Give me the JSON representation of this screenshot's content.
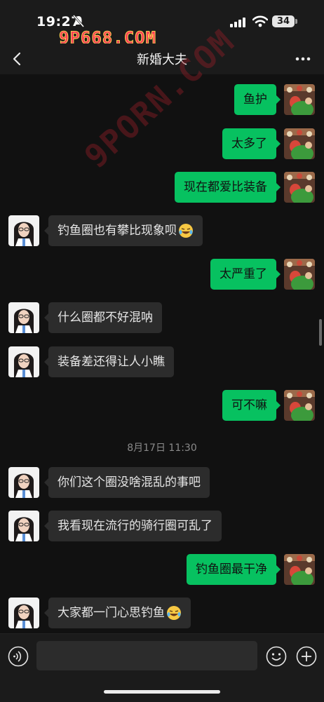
{
  "status_bar": {
    "time": "19:27",
    "battery": "34",
    "watermark_text": "9P668.COM"
  },
  "header": {
    "title": "新婚大夫"
  },
  "overlay_watermark": "9PORN.COM",
  "messages": [
    {
      "side": "out",
      "text": "鱼护"
    },
    {
      "side": "out",
      "text": "太多了"
    },
    {
      "side": "out",
      "text": "现在都爱比装备"
    },
    {
      "side": "in",
      "text": "钓鱼圈也有攀比现象呗",
      "emoji": "laugh-cry-emoji"
    },
    {
      "side": "out",
      "text": "太严重了"
    },
    {
      "side": "in",
      "text": "什么圈都不好混呐"
    },
    {
      "side": "in",
      "text": "装备差还得让人小瞧"
    },
    {
      "side": "out",
      "text": "可不嘛"
    },
    {
      "side": "in",
      "text": "你们这个圈没啥混乱的事吧"
    },
    {
      "side": "in",
      "text": "我看现在流行的骑行圈可乱了"
    },
    {
      "side": "out",
      "text": "钓鱼圈最干净"
    },
    {
      "side": "in",
      "text": "大家都一门心思钓鱼",
      "emoji": "laugh-cry-emoji"
    }
  ],
  "timestamp": "8月17日 11:30",
  "colors": {
    "outgoing_bubble": "#07c160",
    "incoming_bubble": "#2c2c2c",
    "background": "#111111"
  }
}
